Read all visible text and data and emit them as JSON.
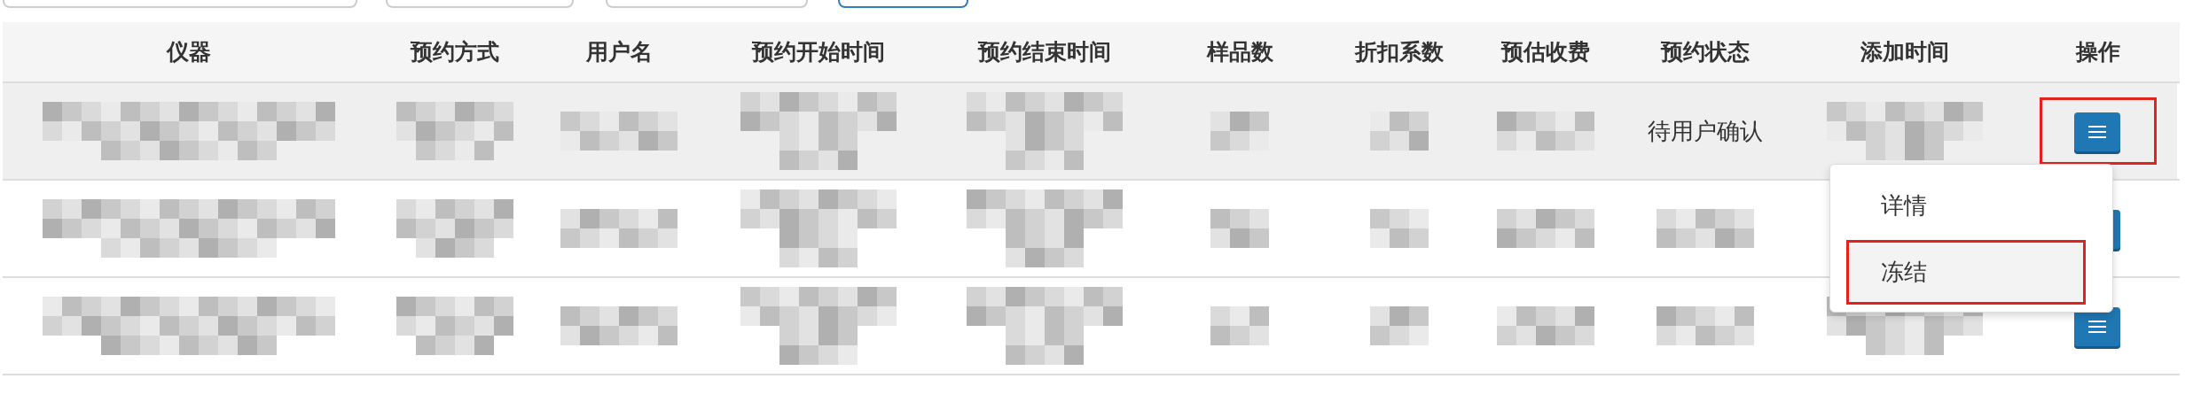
{
  "toolbar": [
    {
      "kind": "field"
    },
    {
      "kind": "field"
    },
    {
      "kind": "field"
    },
    {
      "kind": "button"
    }
  ],
  "table": {
    "columns": [
      "仪器",
      "预约方式",
      "用户名",
      "预约开始时间",
      "预约结束时间",
      "样品数",
      "折扣系数",
      "预估收费",
      "预约状态",
      "添加时间",
      "操作"
    ],
    "rows": [
      {
        "hovered": true,
        "cells": [
          {
            "kind": "redacted"
          },
          {
            "kind": "redacted"
          },
          {
            "kind": "redacted"
          },
          {
            "kind": "redacted"
          },
          {
            "kind": "redacted"
          },
          {
            "kind": "redacted"
          },
          {
            "kind": "redacted"
          },
          {
            "kind": "redacted"
          },
          {
            "kind": "text",
            "text": "待用户确认"
          },
          {
            "kind": "redacted"
          },
          {
            "kind": "menu-button",
            "highlighted": true
          }
        ]
      },
      {
        "hovered": false,
        "cells": [
          {
            "kind": "redacted"
          },
          {
            "kind": "redacted"
          },
          {
            "kind": "redacted"
          },
          {
            "kind": "redacted"
          },
          {
            "kind": "redacted"
          },
          {
            "kind": "redacted"
          },
          {
            "kind": "redacted"
          },
          {
            "kind": "redacted"
          },
          {
            "kind": "redacted"
          },
          {
            "kind": "hidden"
          },
          {
            "kind": "covered-button",
            "highlighted": false
          }
        ]
      },
      {
        "hovered": false,
        "cells": [
          {
            "kind": "redacted"
          },
          {
            "kind": "redacted"
          },
          {
            "kind": "redacted"
          },
          {
            "kind": "redacted"
          },
          {
            "kind": "redacted"
          },
          {
            "kind": "redacted"
          },
          {
            "kind": "redacted"
          },
          {
            "kind": "redacted"
          },
          {
            "kind": "redacted"
          },
          {
            "kind": "redacted"
          },
          {
            "kind": "menu-button",
            "highlighted": false
          }
        ]
      }
    ]
  },
  "dropdown": {
    "items": [
      {
        "label": "详情",
        "hovered": false,
        "highlighted": false
      },
      {
        "label": "冻结",
        "hovered": true,
        "highlighted": true
      }
    ]
  }
}
